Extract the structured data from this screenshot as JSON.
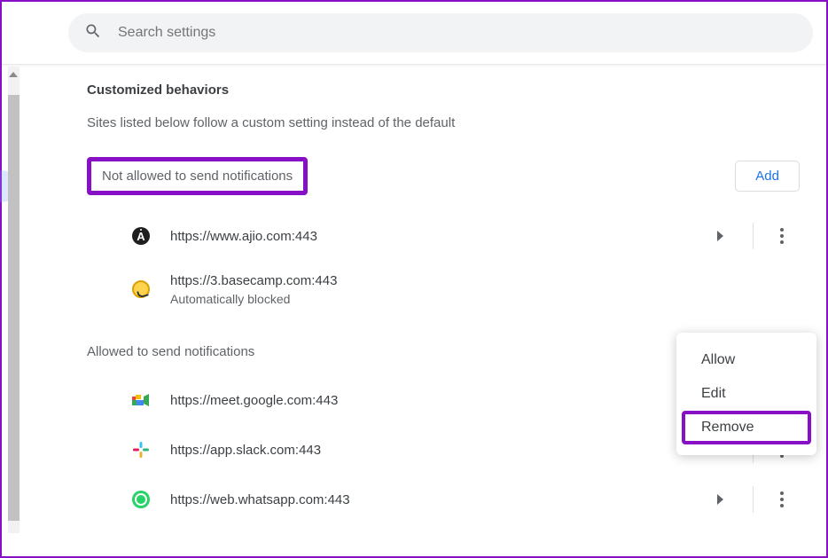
{
  "search": {
    "placeholder": "Search settings"
  },
  "section": {
    "title": "Customized behaviors",
    "subtitle": "Sites listed below follow a custom setting instead of the default"
  },
  "blocked": {
    "label": "Not allowed to send notifications",
    "add_label": "Add",
    "sites": [
      {
        "url": "https://www.ajio.com:443",
        "note": ""
      },
      {
        "url": "https://3.basecamp.com:443",
        "note": "Automatically blocked"
      }
    ]
  },
  "allowed": {
    "label": "Allowed to send notifications",
    "sites": [
      {
        "url": "https://meet.google.com:443"
      },
      {
        "url": "https://app.slack.com:443"
      },
      {
        "url": "https://web.whatsapp.com:443"
      }
    ]
  },
  "menu": {
    "allow": "Allow",
    "edit": "Edit",
    "remove": "Remove"
  }
}
